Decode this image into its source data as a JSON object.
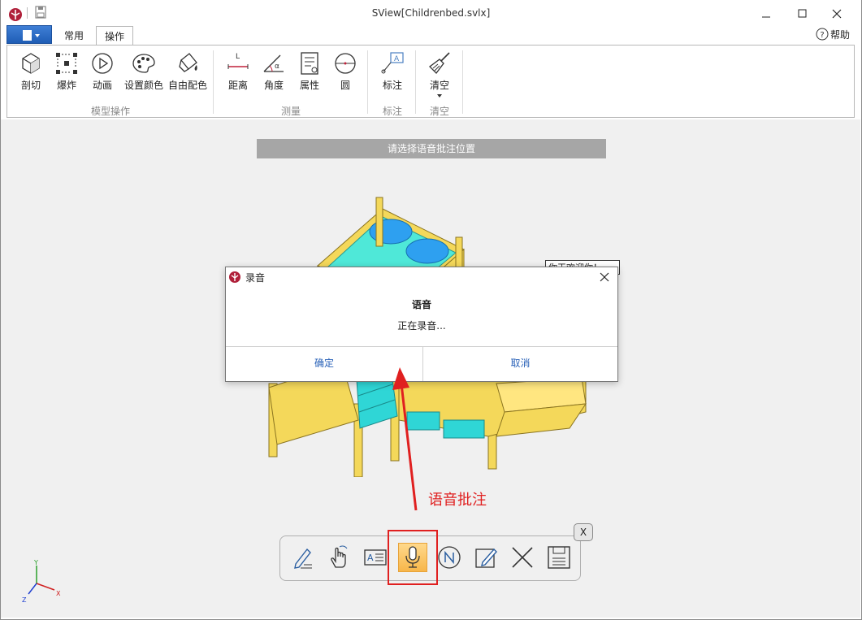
{
  "window": {
    "title": "SView[Childrenbed.svlx]"
  },
  "tabs": [
    {
      "label": "常用",
      "active": false
    },
    {
      "label": "操作",
      "active": true
    }
  ],
  "help": {
    "label": "帮助"
  },
  "ribbon": {
    "groups": [
      {
        "label": "模型操作",
        "buttons": [
          "剖切",
          "爆炸",
          "动画",
          "设置颜色",
          "自由配色"
        ]
      },
      {
        "label": "测量",
        "buttons": [
          "距离",
          "角度",
          "属性",
          "圆"
        ]
      },
      {
        "label": "标注",
        "buttons": [
          "标注"
        ]
      },
      {
        "label": "清空",
        "buttons": [
          "清空"
        ]
      }
    ]
  },
  "viewport": {
    "prompt": "请选择语音批注位置",
    "scene_label": "你王欢迎你！",
    "annotation_text": "语音批注"
  },
  "dialog": {
    "title": "录音",
    "heading": "语音",
    "message": "正在录音...",
    "ok_label": "确定",
    "cancel_label": "取消"
  },
  "toolbar": {
    "close_label": "X",
    "buttons": [
      "pen-annotation-icon",
      "hand-gesture-icon",
      "text-annotation-icon",
      "microphone-icon",
      "note-icon",
      "edit-icon",
      "delete-icon",
      "save-icon"
    ],
    "active_button": "microphone-icon"
  },
  "axes": {
    "y": "Y",
    "z": "Z",
    "x": "X"
  },
  "colors": {
    "accent": "#2a62b8",
    "annotation": "#e02020",
    "active_tool": "#f7b64a"
  }
}
